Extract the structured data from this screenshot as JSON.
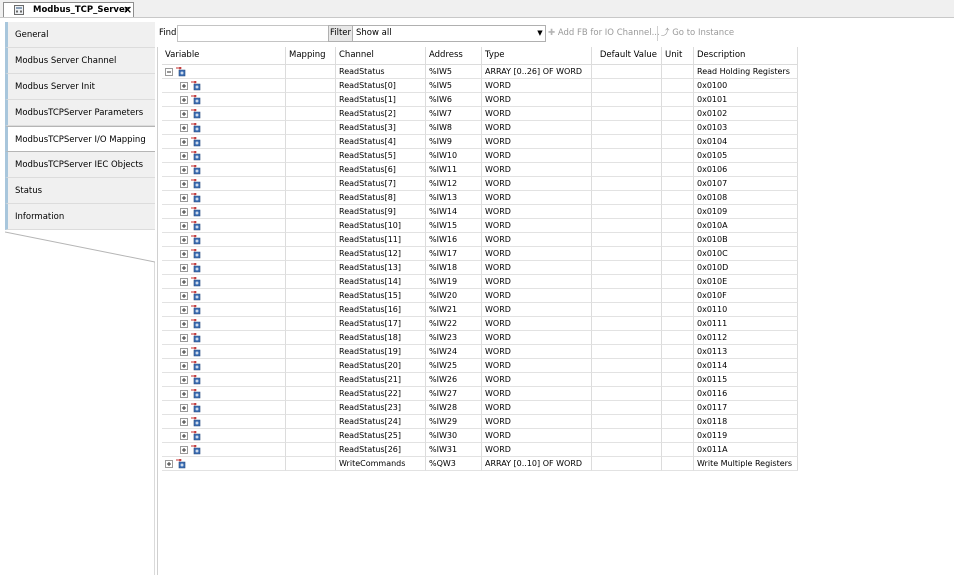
{
  "editor_tab": {
    "title": "Modbus_TCP_Server",
    "close": "×"
  },
  "nav": {
    "items": [
      {
        "label": "General",
        "active": false
      },
      {
        "label": "Modbus Server Channel",
        "active": false
      },
      {
        "label": "Modbus Server Init",
        "active": false
      },
      {
        "label": "ModbusTCPServer Parameters",
        "active": false
      },
      {
        "label": "ModbusTCPServer I/O Mapping",
        "active": true
      },
      {
        "label": "ModbusTCPServer IEC Objects",
        "active": false
      },
      {
        "label": "Status",
        "active": false
      },
      {
        "label": "Information",
        "active": false
      }
    ]
  },
  "toolbar": {
    "find_label": "Find",
    "find_value": "",
    "filter_label": "Filter",
    "filter_value": "Show all",
    "add_fb_label": "Add FB for IO Channel...",
    "goto_label": "Go to Instance"
  },
  "grid": {
    "headers": {
      "variable": "Variable",
      "mapping": "Mapping",
      "channel": "Channel",
      "address": "Address",
      "type": "Type",
      "default": "Default Value",
      "unit": "Unit",
      "description": "Description"
    },
    "rows": [
      {
        "channel": "ReadStatus",
        "address": "%IW5",
        "type": "ARRAY [0..26] OF WORD",
        "description": "Read Holding Registers",
        "level": 0,
        "expanded": true
      },
      {
        "channel": "ReadStatus[0]",
        "address": "%IW5",
        "type": "WORD",
        "description": "0x0100",
        "level": 1,
        "expanded": false
      },
      {
        "channel": "ReadStatus[1]",
        "address": "%IW6",
        "type": "WORD",
        "description": "0x0101",
        "level": 1,
        "expanded": false
      },
      {
        "channel": "ReadStatus[2]",
        "address": "%IW7",
        "type": "WORD",
        "description": "0x0102",
        "level": 1,
        "expanded": false
      },
      {
        "channel": "ReadStatus[3]",
        "address": "%IW8",
        "type": "WORD",
        "description": "0x0103",
        "level": 1,
        "expanded": false
      },
      {
        "channel": "ReadStatus[4]",
        "address": "%IW9",
        "type": "WORD",
        "description": "0x0104",
        "level": 1,
        "expanded": false
      },
      {
        "channel": "ReadStatus[5]",
        "address": "%IW10",
        "type": "WORD",
        "description": "0x0105",
        "level": 1,
        "expanded": false
      },
      {
        "channel": "ReadStatus[6]",
        "address": "%IW11",
        "type": "WORD",
        "description": "0x0106",
        "level": 1,
        "expanded": false
      },
      {
        "channel": "ReadStatus[7]",
        "address": "%IW12",
        "type": "WORD",
        "description": "0x0107",
        "level": 1,
        "expanded": false
      },
      {
        "channel": "ReadStatus[8]",
        "address": "%IW13",
        "type": "WORD",
        "description": "0x0108",
        "level": 1,
        "expanded": false
      },
      {
        "channel": "ReadStatus[9]",
        "address": "%IW14",
        "type": "WORD",
        "description": "0x0109",
        "level": 1,
        "expanded": false
      },
      {
        "channel": "ReadStatus[10]",
        "address": "%IW15",
        "type": "WORD",
        "description": "0x010A",
        "level": 1,
        "expanded": false
      },
      {
        "channel": "ReadStatus[11]",
        "address": "%IW16",
        "type": "WORD",
        "description": "0x010B",
        "level": 1,
        "expanded": false
      },
      {
        "channel": "ReadStatus[12]",
        "address": "%IW17",
        "type": "WORD",
        "description": "0x010C",
        "level": 1,
        "expanded": false
      },
      {
        "channel": "ReadStatus[13]",
        "address": "%IW18",
        "type": "WORD",
        "description": "0x010D",
        "level": 1,
        "expanded": false
      },
      {
        "channel": "ReadStatus[14]",
        "address": "%IW19",
        "type": "WORD",
        "description": "0x010E",
        "level": 1,
        "expanded": false
      },
      {
        "channel": "ReadStatus[15]",
        "address": "%IW20",
        "type": "WORD",
        "description": "0x010F",
        "level": 1,
        "expanded": false
      },
      {
        "channel": "ReadStatus[16]",
        "address": "%IW21",
        "type": "WORD",
        "description": "0x0110",
        "level": 1,
        "expanded": false
      },
      {
        "channel": "ReadStatus[17]",
        "address": "%IW22",
        "type": "WORD",
        "description": "0x0111",
        "level": 1,
        "expanded": false
      },
      {
        "channel": "ReadStatus[18]",
        "address": "%IW23",
        "type": "WORD",
        "description": "0x0112",
        "level": 1,
        "expanded": false
      },
      {
        "channel": "ReadStatus[19]",
        "address": "%IW24",
        "type": "WORD",
        "description": "0x0113",
        "level": 1,
        "expanded": false
      },
      {
        "channel": "ReadStatus[20]",
        "address": "%IW25",
        "type": "WORD",
        "description": "0x0114",
        "level": 1,
        "expanded": false
      },
      {
        "channel": "ReadStatus[21]",
        "address": "%IW26",
        "type": "WORD",
        "description": "0x0115",
        "level": 1,
        "expanded": false
      },
      {
        "channel": "ReadStatus[22]",
        "address": "%IW27",
        "type": "WORD",
        "description": "0x0116",
        "level": 1,
        "expanded": false
      },
      {
        "channel": "ReadStatus[23]",
        "address": "%IW28",
        "type": "WORD",
        "description": "0x0117",
        "level": 1,
        "expanded": false
      },
      {
        "channel": "ReadStatus[24]",
        "address": "%IW29",
        "type": "WORD",
        "description": "0x0118",
        "level": 1,
        "expanded": false
      },
      {
        "channel": "ReadStatus[25]",
        "address": "%IW30",
        "type": "WORD",
        "description": "0x0119",
        "level": 1,
        "expanded": false
      },
      {
        "channel": "ReadStatus[26]",
        "address": "%IW31",
        "type": "WORD",
        "description": "0x011A",
        "level": 1,
        "expanded": false
      },
      {
        "channel": "WriteCommands",
        "address": "%QW3",
        "type": "ARRAY [0..10] OF WORD",
        "description": "Write Multiple Registers",
        "level": 0,
        "expanded": false
      }
    ]
  },
  "colors": {
    "nav_accent": "#a8c6dc",
    "grid_line": "#dcdcdc",
    "disabled_text": "#9a9a9a"
  }
}
